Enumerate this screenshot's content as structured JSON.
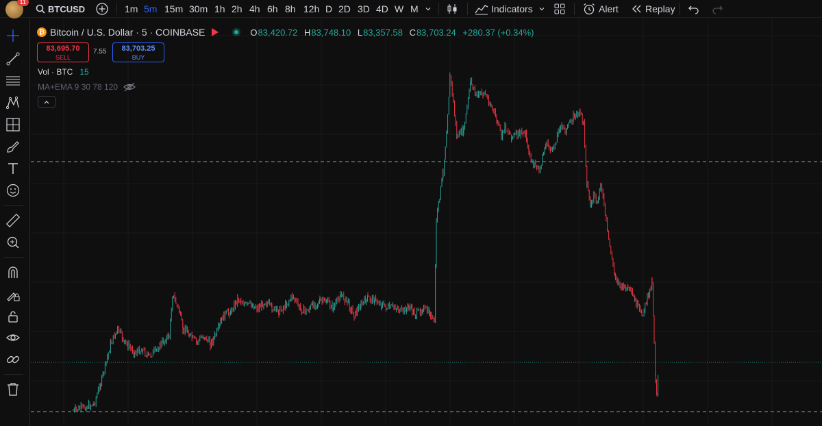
{
  "topbar": {
    "notification_count": "11",
    "symbol": "BTCUSD",
    "intervals": [
      "1m",
      "5m",
      "15m",
      "30m",
      "1h",
      "2h",
      "4h",
      "6h",
      "8h",
      "12h",
      "D",
      "2D",
      "3D",
      "4D",
      "W",
      "M"
    ],
    "active_interval": "5m",
    "indicators_label": "Indicators",
    "alert_label": "Alert",
    "replay_label": "Replay"
  },
  "legend": {
    "title": "Bitcoin / U.S. Dollar · 5 · COINBASE",
    "open_label": "O",
    "open": "83,420.72",
    "high_label": "H",
    "high": "83,748.10",
    "low_label": "L",
    "low": "83,357.58",
    "close_label": "C",
    "close": "83,703.24",
    "change": "+280.37 (+0.34%)"
  },
  "trade": {
    "sell_price": "83,695.70",
    "sell_label": "SELL",
    "spread": "7.55",
    "buy_price": "83,703.25",
    "buy_label": "BUY"
  },
  "volume": {
    "label": "Vol · BTC",
    "value": "15"
  },
  "ma": {
    "label": "MA+EMA 9 30 78 120"
  },
  "colors": {
    "up": "#26a69a",
    "down": "#f23645",
    "accent": "#2962ff",
    "bg": "#0f0f0f"
  },
  "icons": [
    "crosshair-icon",
    "trendline-icon",
    "fib-icon",
    "pattern-icon",
    "projection-icon",
    "brush-icon",
    "text-icon",
    "emoji-icon",
    "ruler-icon",
    "zoom-icon",
    "magnet-icon",
    "lock-draw-icon",
    "lock-icon",
    "eye-icon",
    "link-icon",
    "trash-icon"
  ],
  "chart_data": {
    "type": "line",
    "x": [
      0,
      30,
      40,
      55,
      65,
      75,
      80,
      90,
      100,
      110,
      120,
      130,
      140,
      145,
      155,
      160,
      165,
      170,
      180,
      190,
      200,
      210,
      215,
      220,
      230,
      235,
      240,
      250,
      260,
      270,
      280,
      290,
      300,
      310,
      320,
      330,
      340,
      350,
      360,
      370,
      380,
      390,
      400,
      410,
      420,
      430,
      440,
      450,
      460,
      470,
      480,
      490,
      500,
      510,
      520,
      527,
      530,
      540,
      545,
      550,
      555,
      560,
      570,
      580,
      590,
      600,
      610,
      620,
      625,
      630,
      640,
      650,
      660,
      665,
      670,
      675,
      680,
      690,
      700,
      710,
      720,
      730,
      740,
      745,
      750,
      755,
      760,
      765,
      770,
      780,
      790,
      800,
      810,
      820,
      830,
      840,
      845,
      848,
      850,
      852,
      855
    ],
    "y": [
      600,
      590,
      560,
      500,
      480,
      500,
      505,
      515,
      510,
      520,
      512,
      500,
      490,
      430,
      455,
      482,
      480,
      490,
      500,
      490,
      502,
      485,
      470,
      460,
      455,
      445,
      435,
      445,
      445,
      450,
      440,
      450,
      455,
      445,
      432,
      450,
      455,
      445,
      440,
      440,
      450,
      430,
      440,
      460,
      445,
      435,
      438,
      445,
      450,
      448,
      455,
      448,
      460,
      450,
      458,
      470,
      320,
      250,
      190,
      110,
      150,
      200,
      190,
      120,
      140,
      135,
      155,
      180,
      200,
      185,
      200,
      195,
      195,
      220,
      240,
      240,
      250,
      210,
      220,
      185,
      190,
      170,
      165,
      180,
      270,
      300,
      285,
      300,
      265,
      340,
      400,
      420,
      420,
      440,
      460,
      430,
      410,
      500,
      555,
      575,
      530
    ],
    "title": "",
    "xlabel": "",
    "ylabel": ""
  }
}
